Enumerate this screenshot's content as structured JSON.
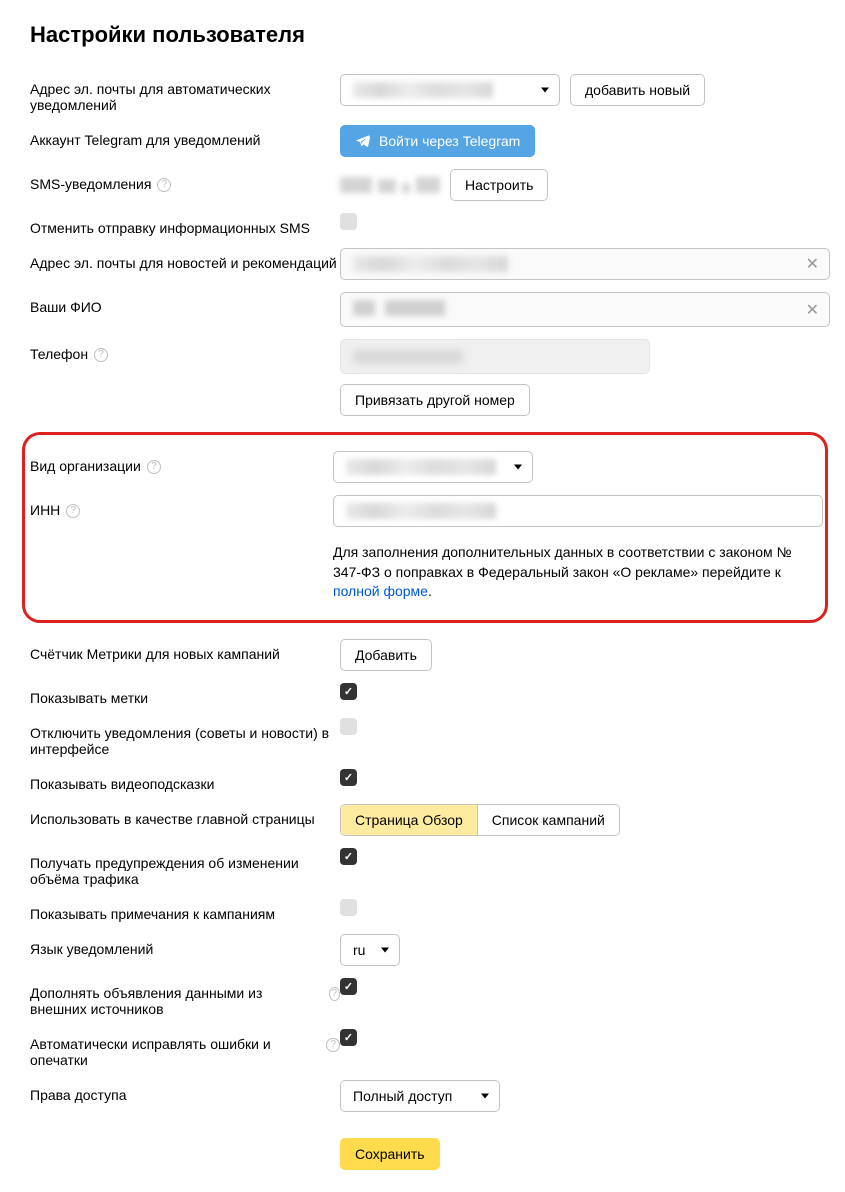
{
  "title": "Настройки пользователя",
  "rows": {
    "email_notify": {
      "label": "Адрес эл. почты для автоматических уведомлений",
      "add_button": "добавить новый"
    },
    "telegram": {
      "label": "Аккаунт Telegram для уведомлений",
      "button": "Войти через Telegram"
    },
    "sms": {
      "label": "SMS-уведомления",
      "config_button": "Настроить"
    },
    "cancel_sms": {
      "label": "Отменить отправку информационных SMS"
    },
    "news_email": {
      "label": "Адрес эл. почты для новостей и рекомендаций"
    },
    "fio": {
      "label": "Ваши ФИО"
    },
    "phone": {
      "label": "Телефон",
      "bind_button": "Привязать другой номер"
    },
    "org_type": {
      "label": "Вид организации"
    },
    "inn": {
      "label": "ИНН",
      "hint_pre": "Для заполнения дополнительных данных в соответствии с законом № 347-ФЗ о поправках в Федеральный закон «О рекламе» перейдите к ",
      "hint_link": "полной форме",
      "hint_post": "."
    },
    "metrika": {
      "label": "Счётчик Метрики для новых кампаний",
      "button": "Добавить"
    },
    "tags": {
      "label": "Показывать метки"
    },
    "disable_tips": {
      "label": "Отключить уведомления (советы и новости) в интерфейсе"
    },
    "video_hints": {
      "label": "Показывать видеоподсказки"
    },
    "homepage": {
      "label": "Использовать в качестве главной страницы",
      "opt1": "Страница Обзор",
      "opt2": "Список кампаний"
    },
    "traffic_warn": {
      "label": "Получать предупреждения об изменении объёма трафика"
    },
    "campaign_notes": {
      "label": "Показывать примечания к кампаниям"
    },
    "notif_lang": {
      "label": "Язык уведомлений",
      "value": "ru"
    },
    "external_data": {
      "label": "Дополнять объявления данными из внешних источников"
    },
    "auto_fix": {
      "label": "Автоматически исправлять ошибки и опечатки"
    },
    "access": {
      "label": "Права доступа",
      "value": "Полный доступ"
    }
  },
  "save_button": "Сохранить"
}
